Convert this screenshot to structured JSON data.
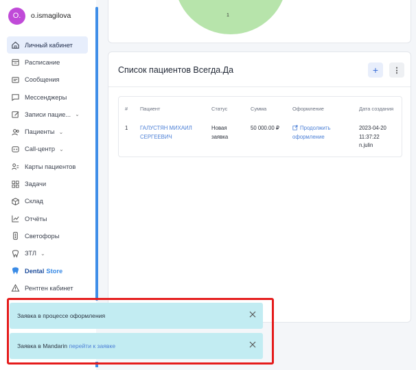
{
  "user": {
    "avatar_letter": "O.",
    "name": "o.ismagilova"
  },
  "sidebar": {
    "items": [
      {
        "label": "Личный кабинет",
        "icon": "home-icon",
        "active": true
      },
      {
        "label": "Расписание",
        "icon": "calendar-icon"
      },
      {
        "label": "Сообщения",
        "icon": "message-icon"
      },
      {
        "label": "Мессенджеры",
        "icon": "chat-icon"
      },
      {
        "label": "Записи пацие...",
        "icon": "edit-icon",
        "chevron": "⌄"
      },
      {
        "label": "Пациенты",
        "icon": "users-icon",
        "chevron": "⌄"
      },
      {
        "label": "Call-центр",
        "icon": "phone-icon",
        "chevron": "⌄"
      },
      {
        "label": "Карты пациентов",
        "icon": "patient-cards-icon"
      },
      {
        "label": "Задачи",
        "icon": "tasks-icon"
      },
      {
        "label": "Склад",
        "icon": "box-icon"
      },
      {
        "label": "Отчёты",
        "icon": "chart-icon"
      },
      {
        "label": "Светофоры",
        "icon": "traffic-light-icon"
      },
      {
        "label": "ЗТЛ",
        "icon": "tooth-icon",
        "chevron": "⌄"
      },
      {
        "label_part1": "Dental",
        "label_part2": "Store",
        "icon": "dental-store-icon"
      },
      {
        "label": "Рентген кабинет",
        "icon": "warning-icon"
      }
    ]
  },
  "top_card": {
    "chart_label": "1"
  },
  "patients": {
    "title": "Список пациентов Всегда.Да",
    "add_label": "+",
    "more_label": "⋮",
    "columns": [
      "#",
      "Пациент",
      "Статус",
      "Сумма",
      "Оформление",
      "Дата создания"
    ],
    "rows": [
      {
        "num": "1",
        "patient_line1": "ГАЛУСТЯН МИХАИЛ",
        "patient_line2": "СЕРГЕЕВИЧ",
        "status_line1": "Новая",
        "status_line2": "заявка",
        "amount": "50 000.00 ₽",
        "action_line1": "Продолжить",
        "action_line2": "оформление",
        "date": "2023-04-20",
        "time": "11:37:22",
        "author": "n.julin"
      }
    ]
  },
  "notifications": [
    {
      "text": "Заявка в процессе оформления"
    },
    {
      "text": "Заявка в Mandarin",
      "link": "перейти к заявке"
    }
  ],
  "colors": {
    "accent": "#3f8ee8",
    "highlight": "#e51b1b",
    "toast": "#c2ecf2"
  }
}
